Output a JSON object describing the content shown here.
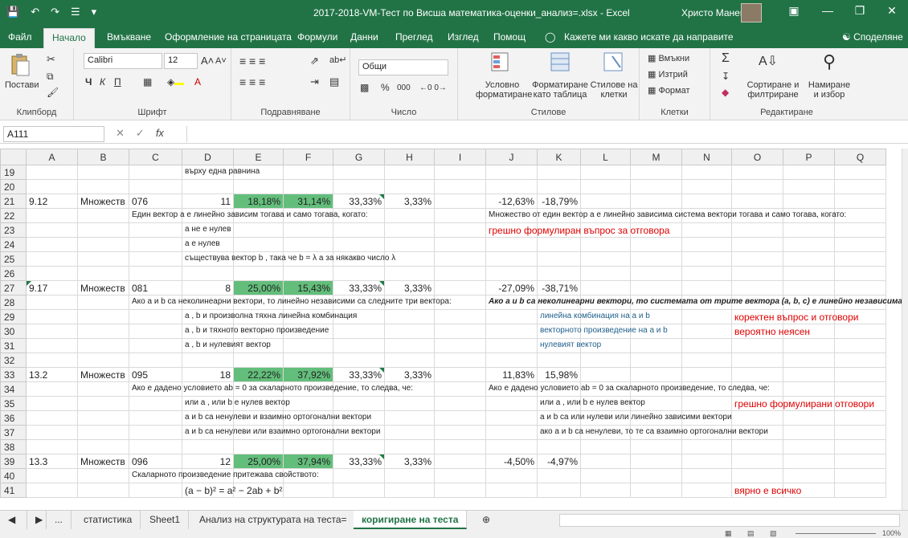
{
  "window": {
    "title": "2017-2018-VM-Тест по Висша математика-оценки_анализ=.xlsx  -  Excel",
    "user": "Христо Манев",
    "qat": [
      "save-icon",
      "undo-icon",
      "redo-icon",
      "touch-mode-icon",
      "customize-icon"
    ]
  },
  "menu": {
    "tabs": [
      "Файл",
      "Начало",
      "Вмъкване",
      "Оформление на страницата",
      "Формули",
      "Данни",
      "Преглед",
      "Изглед",
      "Помощ"
    ],
    "active": "Начало",
    "tell_me": "Кажете ми какво искате да направите",
    "share": "Споделяне"
  },
  "ribbon": {
    "clipboard": {
      "label": "Клипборд",
      "paste": "Постави"
    },
    "font": {
      "label": "Шрифт",
      "name": "Calibri",
      "size": "12",
      "bold": "Ч",
      "italic": "К",
      "underline": "П"
    },
    "alignment": {
      "label": "Подравняване"
    },
    "number": {
      "label": "Число",
      "format": "Общи"
    },
    "styles": {
      "label": "Стилове",
      "conditional": "Условно форматиране",
      "as_table": "Форматиране като таблица",
      "cell_styles": "Стилове на клетки"
    },
    "cells": {
      "label": "Клетки",
      "insert": "Вмъкни",
      "delete": "Изтрий",
      "format": "Формат"
    },
    "editing": {
      "label": "Редактиране",
      "sort": "Сортиране и филтриране",
      "find": "Намиране и избор"
    }
  },
  "formula_bar": {
    "name_box": "A111",
    "fx": "fx",
    "value": ""
  },
  "columns": [
    "A",
    "B",
    "C",
    "D",
    "E",
    "F",
    "G",
    "H",
    "I",
    "J",
    "K",
    "L",
    "M",
    "N",
    "O",
    "P",
    "Q"
  ],
  "rows": {
    "r19": {
      "num": "19",
      "D": "върху една равнина"
    },
    "r20": {
      "num": "20"
    },
    "r21": {
      "num": "21",
      "A": "9.12",
      "B": "Множеств",
      "C": "076",
      "D": "11",
      "E": "18,18%",
      "F": "31,14%",
      "G": "33,33%",
      "H": "3,33%",
      "J": "-12,63%",
      "K": "-18,79%"
    },
    "r22": {
      "num": "22",
      "C": "Един вектор a  е линейно зависим тогава и само тогава, когато:",
      "J": "Множество от един вектор a  е линейно зависима система вектори тогава и само тогава, когато:"
    },
    "r23": {
      "num": "23",
      "D": "a  не е нулев",
      "J": "грешно формулиран въпрос за отговора"
    },
    "r24": {
      "num": "24",
      "D": "a  е нулев"
    },
    "r25": {
      "num": "25",
      "D": "съществува вектор b , така че b  = λ a   за някакво число λ"
    },
    "r26": {
      "num": "26"
    },
    "r27": {
      "num": "27",
      "A": "9.17",
      "B": "Множеств",
      "C": "081",
      "D": "8",
      "E": "25,00%",
      "F": "15,43%",
      "G": "33,33%",
      "H": "3,33%",
      "J": "-27,09%",
      "K": "-38,71%"
    },
    "r28": {
      "num": "28",
      "C": "Ако a  и b  са неколинеарни вектори, то линейно независими са следните три вектора:",
      "J": "Ако a и b са неколинеарни вектори, то системата от трите вектора (a, b, c) е линейно независима"
    },
    "r29": {
      "num": "29",
      "D": "a , b  и произволна тяхна линейна комбинация",
      "K": "линейна комбинация на a  и b",
      "O": "коректен въпрос и отговори"
    },
    "r30": {
      "num": "30",
      "D": "a , b  и тяхното векторно произведение",
      "K": "векторното произведение на a  и b",
      "O": "вероятно неясен"
    },
    "r31": {
      "num": "31",
      "D": "a , b  и нулевият вектор",
      "K": "нулевият вектор"
    },
    "r32": {
      "num": "32"
    },
    "r33": {
      "num": "33",
      "A": "13.2",
      "B": "Множеств",
      "C": "095",
      "D": "18",
      "E": "22,22%",
      "F": "37,92%",
      "G": "33,33%",
      "H": "3,33%",
      "J": "11,83%",
      "K": "15,98%"
    },
    "r34": {
      "num": "34",
      "C": "Ако е дадено условието ab  = 0 за скаларното произведение, то следва, че:",
      "J": "Ако е дадено условието ab  = 0 за скаларното произведение, то следва, че:"
    },
    "r35": {
      "num": "35",
      "D": "или a , или b  е нулев вектор",
      "K": "или a , или b  е нулев вектор",
      "O": "грешно формулирани отговори"
    },
    "r36": {
      "num": "36",
      "D": "a  и b  са ненулеви и взаимно ортогонални вектори",
      "K": "a  и b  са или нулеви или линейно зависими вектори"
    },
    "r37": {
      "num": "37",
      "D": "a  и b  са ненулеви или взаимно ортогонални вектори",
      "K": "ако a  и b  са ненулеви, то те са взаимно ортогонални вектори"
    },
    "r38": {
      "num": "38"
    },
    "r39": {
      "num": "39",
      "A": "13.3",
      "B": "Множеств",
      "C": "096",
      "D": "12",
      "E": "25,00%",
      "F": "37,94%",
      "G": "33,33%",
      "H": "3,33%",
      "J": "-4,50%",
      "K": "-4,97%"
    },
    "r40": {
      "num": "40",
      "C": "Скаларното произведение притежава свойството:"
    },
    "r41": {
      "num": "41",
      "D": "(a − b)² = a² − 2ab + b²",
      "O": "вярно е всичко"
    }
  },
  "sheet_tabs": {
    "ellipsis": "...",
    "tabs": [
      "статистика",
      "Sheet1",
      "Анализ на структурата на теста=",
      "коригиране на теста"
    ],
    "active": "коригиране на теста"
  },
  "status": {
    "zoom": "100%"
  },
  "colors": {
    "excel_green": "#217346",
    "cell_green": "#63be7b",
    "red_text": "#e00000"
  }
}
